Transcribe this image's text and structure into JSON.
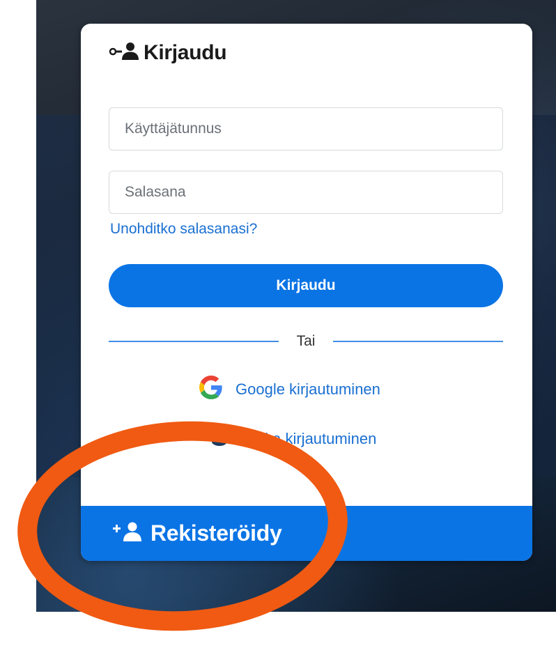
{
  "login": {
    "title": "Kirjaudu",
    "header_icon": "user-key-icon",
    "username": {
      "value": "",
      "placeholder": "Käyttäjätunnus"
    },
    "password": {
      "value": "",
      "placeholder": "Salasana"
    },
    "forgot_link": "Unohditko salasanasi?",
    "submit_label": "Kirjaudu",
    "divider_text": "Tai",
    "social": [
      {
        "label": "Google kirjautuminen",
        "icon": "google-icon"
      },
      {
        "label": "Haka kirjautuminen",
        "icon": "graduation-cap-icon"
      }
    ],
    "register_label": "Rekisteröidy",
    "register_icon": "user-plus-icon"
  },
  "colors": {
    "primary": "#0b74e5",
    "link": "#1a6fd1",
    "annotation": "#f05a12",
    "title": "#1a1a1a"
  }
}
